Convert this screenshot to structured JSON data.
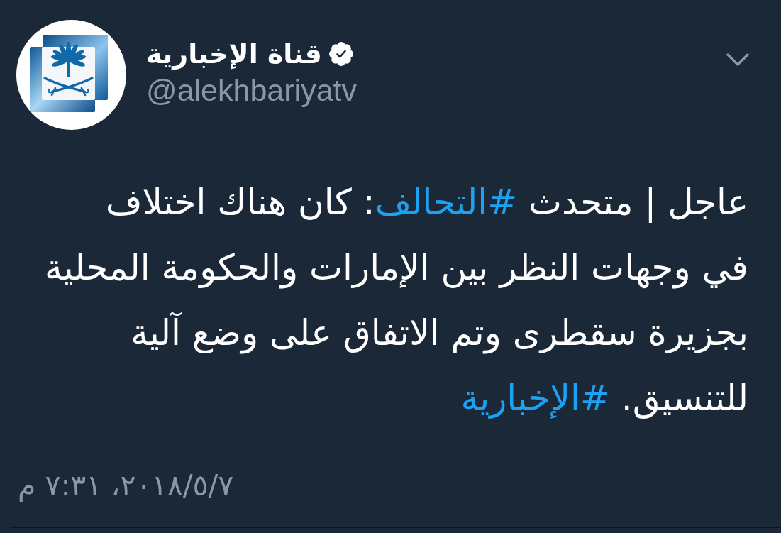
{
  "tweet": {
    "author": {
      "name": "قناة الإخبارية",
      "verified": true,
      "handle": "@alekhbariyatv"
    },
    "body_lines": [
      [
        {
          "kind": "text",
          "text": "عاجل | متحدث "
        },
        {
          "kind": "hashtag",
          "text": "#التحالف"
        },
        {
          "kind": "text",
          "text": ": كان هناك اختلاف"
        }
      ],
      [
        {
          "kind": "text",
          "text": "في وجهات النظر بين الإمارات والحكومة المحلية"
        }
      ],
      [
        {
          "kind": "text",
          "text": "بجزيرة سقطرى وتم الاتفاق على وضع آلية"
        }
      ],
      [
        {
          "kind": "text",
          "text": "للتنسيق. "
        },
        {
          "kind": "hashtag",
          "text": "#الإخبارية"
        }
      ]
    ],
    "timestamp": "٢٠١٨/٥/٧، ٧:٣١ م"
  }
}
